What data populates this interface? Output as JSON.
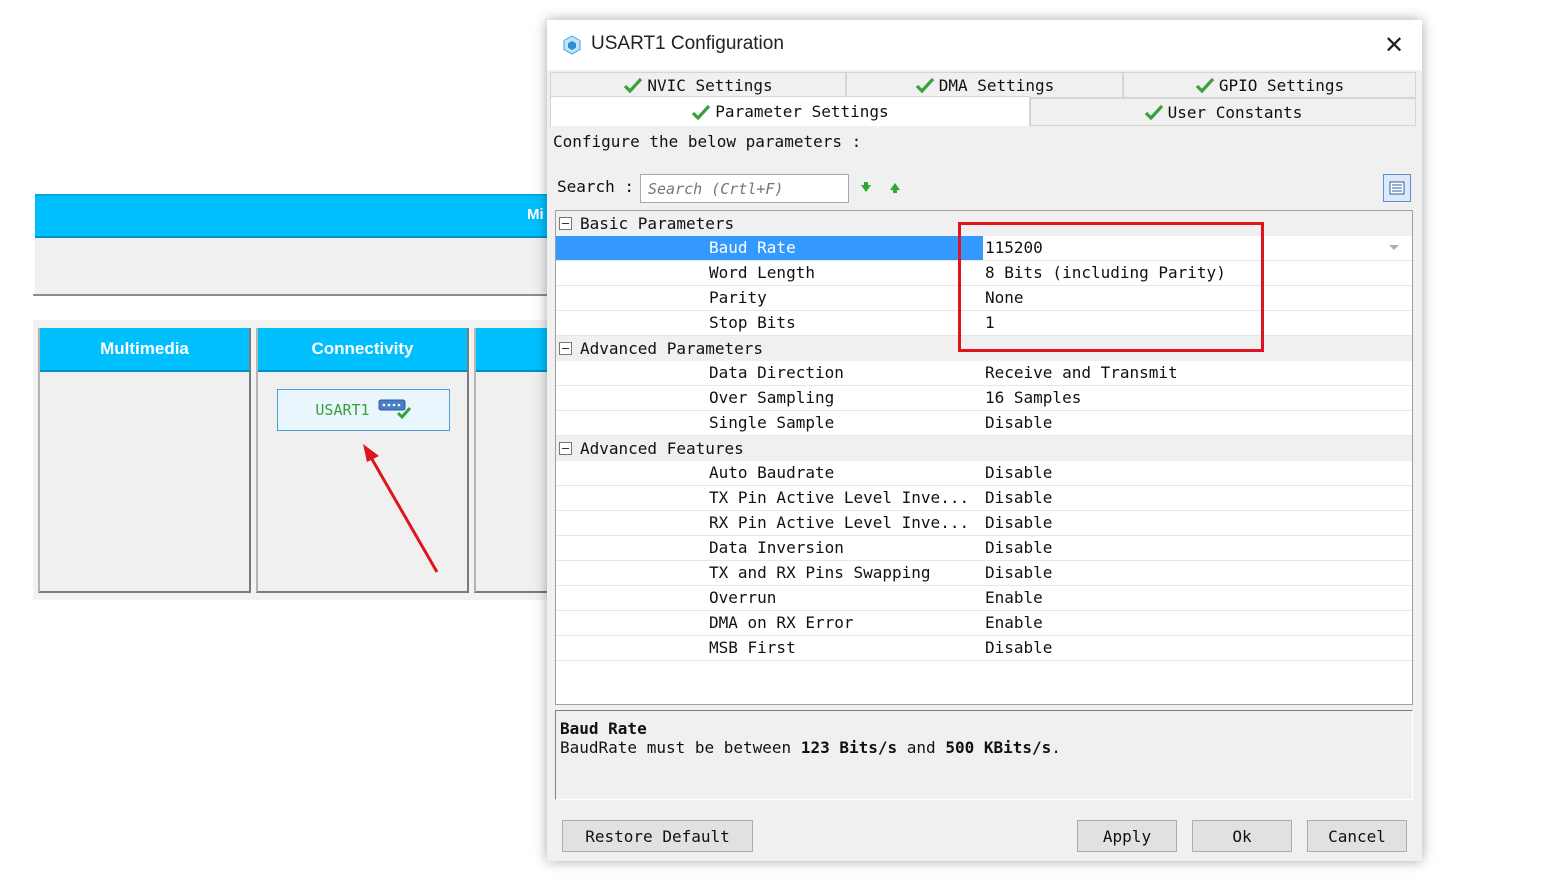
{
  "background": {
    "middleware_bar_label": "Mi",
    "categories": [
      {
        "label": "Multimedia"
      },
      {
        "label": "Connectivity"
      },
      {
        "label": ""
      }
    ],
    "peripheral_button": {
      "label": "USART1",
      "icon": "serial-port-icon"
    }
  },
  "dialog": {
    "title": "USART1 Configuration",
    "title_icon": "cube-icon",
    "close_label": "✕",
    "tabs": [
      {
        "label": "NVIC Settings",
        "active": false
      },
      {
        "label": "DMA Settings",
        "active": false
      },
      {
        "label": "GPIO Settings",
        "active": false
      },
      {
        "label": "Parameter Settings",
        "active": true
      },
      {
        "label": "User Constants",
        "active": false
      }
    ],
    "configure_label": "Configure the below parameters :",
    "search": {
      "label": "Search :",
      "placeholder": "Search (Crtl+F)"
    },
    "sections": [
      {
        "title": "Basic Parameters",
        "params": [
          {
            "name": "Baud Rate",
            "value": "115200",
            "selected": true
          },
          {
            "name": "Word Length",
            "value": "8 Bits (including Parity)"
          },
          {
            "name": "Parity",
            "value": "None"
          },
          {
            "name": "Stop Bits",
            "value": "1"
          }
        ]
      },
      {
        "title": "Advanced Parameters",
        "params": [
          {
            "name": "Data Direction",
            "value": "Receive and Transmit"
          },
          {
            "name": "Over Sampling",
            "value": "16 Samples"
          },
          {
            "name": "Single Sample",
            "value": "Disable"
          }
        ]
      },
      {
        "title": "Advanced Features",
        "params": [
          {
            "name": "Auto Baudrate",
            "value": "Disable"
          },
          {
            "name": "TX Pin Active Level Inve...",
            "value": "Disable"
          },
          {
            "name": "RX Pin Active Level Inve...",
            "value": "Disable"
          },
          {
            "name": "Data Inversion",
            "value": "Disable"
          },
          {
            "name": "TX and RX Pins Swapping",
            "value": "Disable"
          },
          {
            "name": "Overrun",
            "value": "Enable"
          },
          {
            "name": "DMA on RX Error",
            "value": "Enable"
          },
          {
            "name": "MSB First",
            "value": "Disable"
          }
        ]
      }
    ],
    "description": {
      "title": "Baud Rate",
      "text_prefix": "BaudRate must be between ",
      "min": "123 Bits/s",
      "text_mid": " and ",
      "max": "500 KBits/s",
      "text_suffix": "."
    },
    "buttons": {
      "restore": "Restore Default",
      "apply": "Apply",
      "ok": "Ok",
      "cancel": "Cancel"
    }
  },
  "colors": {
    "category_header": "#00bfff",
    "selection": "#3399ff",
    "annotation_red": "#e0141e",
    "check_green": "#3aa03a"
  }
}
